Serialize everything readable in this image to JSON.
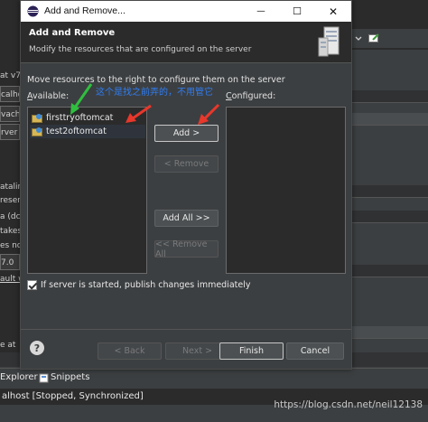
{
  "window": {
    "title": "Add and Remove...",
    "minimize": "—",
    "maximize": "☐",
    "close": "✕"
  },
  "header": {
    "title": "Add and Remove",
    "description": "Modify the resources that are configured on the server"
  },
  "instruction": "Move resources to the right to configure them on the server",
  "annotation": "这个是找之前弄的，不用管它",
  "available": {
    "label": "Available:",
    "items": [
      "firsttryoftomcat",
      "test2oftomcat"
    ]
  },
  "configured": {
    "label": "Configured:",
    "items": []
  },
  "buttons": {
    "add": "Add >",
    "remove": "< Remove",
    "add_all": "Add All >>",
    "remove_all": "<< Remove All",
    "back": "< Back",
    "next": "Next >",
    "finish": "Finish",
    "cancel": "Cancel"
  },
  "checkbox": {
    "label": "If server is started, publish changes immediately",
    "checked": true
  },
  "background": {
    "left_snippets": [
      "at v7.",
      "calho",
      "vache",
      "rver",
      "atalin",
      "reser",
      "a (dc",
      "takes",
      "es no",
      "7.0",
      "ault w",
      "e at"
    ],
    "tabs": [
      "Explorer",
      "Snippets"
    ],
    "status": "alhost  [Stopped, Synchronized]",
    "watermark": "https://blog.csdn.net/neil12138"
  },
  "colors": {
    "accent_arrow_red": "#e8372b",
    "annotation_arrow_green": "#2fbf3f",
    "annotation_text": "#2f7df2"
  }
}
